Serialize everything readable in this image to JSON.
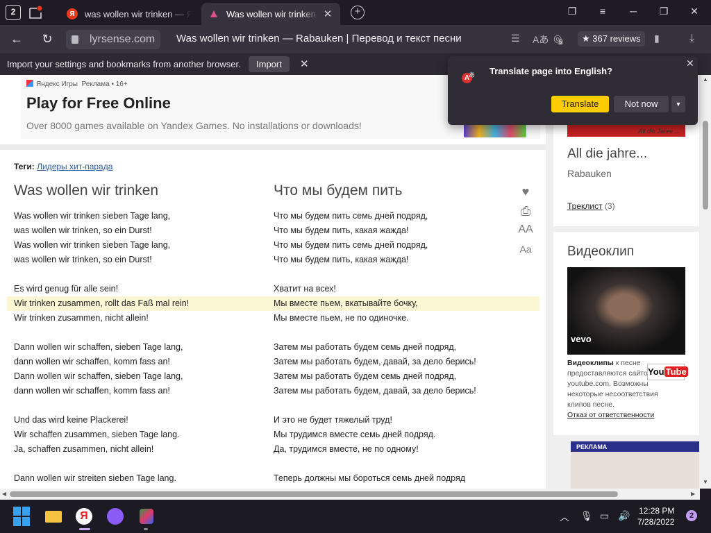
{
  "browser": {
    "tab_count": "2",
    "tabs": [
      {
        "title": "was wollen wir trinken — Я"
      },
      {
        "title": "Was wollen wir trinken — "
      }
    ],
    "url": "lyrsense.com",
    "page_title": "Was wollen wir trinken — Rabauken | Перевод и текст песни",
    "reviews": "★ 367 reviews",
    "extension_badge": "5"
  },
  "import_bar": {
    "text": "Import your settings and bookmarks from another browser.",
    "button": "Import"
  },
  "translate_popup": {
    "title": "Translate page into English?",
    "translate_button": "Translate",
    "not_now_button": "Not now"
  },
  "ad": {
    "brand": "Яндекс Игры",
    "meta": "Реклама • 16+",
    "title": "Play for Free Online",
    "subtitle": "Over 8000 games available on Yandex Games. No installations or downloads!"
  },
  "song": {
    "tags_label": "Теги:",
    "tags_link": "Лидеры хит-парада",
    "title_de": "Was wollen wir trinken",
    "title_ru": "Что мы будем пить",
    "lyrics_de": [
      "Was wollen wir trinken sieben Tage lang,",
      "was wollen wir trinken, so ein Durst!",
      "Was wollen wir trinken sieben Tage lang,",
      "was wollen wir trinken, so ein Durst!",
      "",
      "Es wird genug für alle sein!",
      "Wir trinken zusammen, rollt das Faß mal rein!",
      "Wir trinken zusammen, nicht allein!",
      "",
      "Dann wollen wir schaffen, sieben Tage lang,",
      "dann wollen wir schaffen, komm fass an!",
      "Dann wollen wir schaffen, sieben Tage lang,",
      "dann wollen wir schaffen, komm fass an!",
      "",
      "Und das wird keine Plackerei!",
      "Wir schaffen zusammen, sieben Tage lang.",
      "Ja, schaffen zusammen, nicht allein!",
      "",
      "Dann wollen wir streiten sieben Tage lang."
    ],
    "lyrics_ru": [
      "Что мы будем пить семь дней подряд,",
      "Что мы будем пить, какая жажда!",
      "Что мы будем пить семь дней подряд,",
      "Что мы будем пить, какая жажда!",
      "",
      "Хватит на всех!",
      "Мы вместе пьем, вкатывайте бочку,",
      "Мы вместе пьем, не по одиночке.",
      "",
      "Затем мы работать будем семь дней подряд,",
      "Затем мы работать будем, давай, за дело берись!",
      "Затем мы работать будем семь дней подряд,",
      "Затем мы работать будем, давай, за дело берись!",
      "",
      "И это не будет тяжелый труд!",
      "Мы трудимся вместе семь дней подряд.",
      "Да, трудимся вместе, не по одному!",
      "",
      "Теперь должны мы бороться семь дней подряд"
    ]
  },
  "sidebar": {
    "album_cover_text": "All die Jahre ...",
    "album_title": "All die jahre...",
    "artist": "Rabauken",
    "tracklist_link": "Треклист",
    "tracklist_count": "(3)",
    "video_heading": "Видеоклип",
    "vevo": "vevo",
    "video_text_bold": "Видеоклипы",
    "video_text": " к песне предоставляются сайтом youtube.com. Возможны некоторые несоответствия клипов песне.",
    "disclaimer_link": "Отказ от ответственности",
    "youtube_logo": "You",
    "youtube_logo_tube": "Tube",
    "ad_label": "РЕКЛАМА"
  },
  "taskbar": {
    "time": "12:28 PM",
    "date": "7/28/2022",
    "notifications": "2",
    "yandex_letter": "Я"
  },
  "colors": {
    "translate_button": "#ffcc00",
    "highlight_row": "#fbf6d4",
    "tab_active": "#37333e"
  }
}
